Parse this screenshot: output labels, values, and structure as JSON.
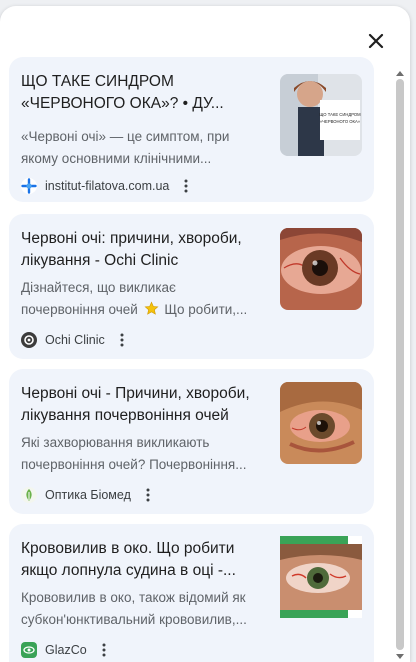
{
  "panel": {
    "close_icon": "close-icon"
  },
  "results": [
    {
      "title_line1": "ЩО ТАКЕ СИНДРОМ",
      "title_line2": "«ЧЕРВОНОГО ОКА»? • ДУ...",
      "snippet_line1": "«Червоні очі» — це симптом, при",
      "snippet_line2": "якому основними клінічними...",
      "source": "institut-filatova.com.ua",
      "favicon_icon": "institut-filatova-logo-icon",
      "thumb_caption_1": "ЩО ТАКЕ СИНДРОМ",
      "thumb_caption_2": "«ЧЕРВОНОГО ОКА»"
    },
    {
      "title_line1": "Червоні очі: причини, хвороби,",
      "title_line2": "лікування - Ochi Clinic",
      "snippet_line1": "Дізнайтеся, що викликає",
      "snippet_line2a": "почервоніння очей",
      "snippet_line2b": "Що робити,...",
      "source": "Ochi Clinic",
      "favicon_icon": "ochi-clinic-logo-icon",
      "emoji_icon": "star-icon"
    },
    {
      "title_line1": "Червоні очі - Причини, хвороби,",
      "title_line2": "лікування почервоніння очей",
      "snippet_line1": "Які захворювання викликають",
      "snippet_line2": "почервоніння очей? Почервоніння...",
      "source": "Оптика Біомед",
      "favicon_icon": "optika-biomed-logo-icon"
    },
    {
      "title_line1": "Крововилив в око. Що робити",
      "title_line2": "якщо лопнула судина в оці -...",
      "snippet_line1": "Крововилив в око, також відомий як",
      "snippet_line2": "субкон'юнктивальний крововилив,...",
      "source": "GlazCo",
      "favicon_icon": "glazco-logo-icon"
    }
  ],
  "colors": {
    "card_bg": "#f0f4fb",
    "title": "#1f1f1f",
    "snippet": "#5f6368",
    "scrollbar": "#c8c8c8"
  }
}
